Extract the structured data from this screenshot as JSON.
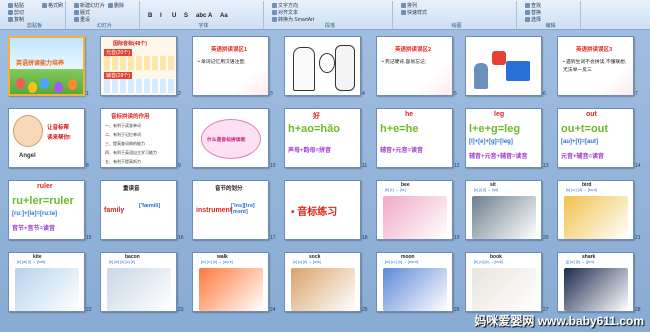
{
  "ribbon": {
    "groups": [
      {
        "label": "剪贴板",
        "buttons": [
          "粘贴",
          "剪切",
          "复制",
          "格式刷"
        ]
      },
      {
        "label": "幻灯片",
        "buttons": [
          "新建幻灯片",
          "版式",
          "重设",
          "删除"
        ]
      },
      {
        "label": "字体",
        "buttons": [
          "B",
          "I",
          "U",
          "S",
          "abc",
          "A",
          "Aa"
        ]
      },
      {
        "label": "段落",
        "buttons": [
          "文字方向",
          "对齐文本",
          "转换为 SmartArt"
        ]
      },
      {
        "label": "绘图",
        "buttons": [
          "排列",
          "快速样式"
        ]
      },
      {
        "label": "编辑",
        "buttons": [
          "查找",
          "替换",
          "选择"
        ]
      }
    ]
  },
  "slides": [
    {
      "n": "1",
      "title": "英语拼读能力培养",
      "kind": "cover"
    },
    {
      "n": "2",
      "lines": [
        "国际音标(48个)",
        "元音(20个)",
        "辅音(28个)"
      ],
      "kind": "ipa"
    },
    {
      "n": "3",
      "title": "英语拼读误区1",
      "body": "单词记忆用汉语注音;",
      "kind": "text"
    },
    {
      "n": "4",
      "kind": "cartoon"
    },
    {
      "n": "5",
      "title": "英语拼读误区2",
      "body": "死记硬背,容易忘记;",
      "kind": "text"
    },
    {
      "n": "6",
      "kind": "question"
    },
    {
      "n": "7",
      "title": "英语拼读误区3",
      "body": "遇到生词不会拼读,不懂联想,无法举一反三",
      "kind": "text"
    },
    {
      "n": "8",
      "text1": "让音标帮",
      "text2": "读来帮你!",
      "name": "Angel",
      "kind": "angel"
    },
    {
      "n": "9",
      "title": "音标拼读的作用",
      "lines": [
        "一、有利于读准单词",
        "二、有利于记忆单词",
        "三、提高查词典的能力",
        "四、有利于英语自主学习能力",
        "五、有利于提高听力"
      ],
      "kind": "list"
    },
    {
      "n": "10",
      "title": "什么是音标拼读呢",
      "kind": "bubble"
    },
    {
      "n": "11",
      "top": "好",
      "formula": "h+ao=hǎo",
      "sub": "声母+韵母=拼音",
      "kind": "formula"
    },
    {
      "n": "12",
      "top": "he",
      "formula": "h+e=he",
      "sub": "辅音+元音=读音",
      "kind": "formula"
    },
    {
      "n": "13",
      "top": "leg",
      "formula": "l+e+g=leg",
      "mid": "[l]+[e]+[g]=[leg]",
      "sub": "辅音+元音+辅音=读音",
      "kind": "formula"
    },
    {
      "n": "14",
      "top": "out",
      "formula": "ou+t=out",
      "mid": "[au]+[t]=[aut]",
      "sub": "元音+辅音=读音",
      "kind": "formula"
    },
    {
      "n": "15",
      "top": "ruler",
      "formula": "ru+ler=ruler",
      "mid": "[ru:]+[lə]=[ru:lə]",
      "sub": "音节+音节=读音",
      "kind": "formula"
    },
    {
      "n": "16",
      "title": "重读音",
      "word": "family",
      "ipa": "['fæmili]",
      "kind": "stress"
    },
    {
      "n": "17",
      "title": "音节的划分",
      "word": "instrument",
      "ipa": "['ins][trə][mənt]",
      "kind": "stress"
    },
    {
      "n": "18",
      "title": "音标练习",
      "kind": "practice"
    },
    {
      "n": "19",
      "word": "bee",
      "ipa": "[b] [i:] → [bi:]",
      "kind": "photo"
    },
    {
      "n": "20",
      "word": "sit",
      "ipa": "[s] [i] [t] → [sit]",
      "kind": "photo"
    },
    {
      "n": "21",
      "word": "bird",
      "ipa": "[b] [ə:] [d] → [bə:d]",
      "kind": "photo"
    },
    {
      "n": "22",
      "word": "kite",
      "ipa": "[k] [ai] [t] → [kait]",
      "kind": "photo"
    },
    {
      "n": "23",
      "word": "bacon",
      "ipa": "[b] [ei] [k] [ə] [n]",
      "kind": "photo"
    },
    {
      "n": "24",
      "word": "walk",
      "ipa": "[w] [ɔ:] [k] → [wɔ:k]",
      "kind": "photo"
    },
    {
      "n": "25",
      "word": "sock",
      "ipa": "[s] [ɔ] [k] → [sɔk]",
      "kind": "photo"
    },
    {
      "n": "26",
      "word": "moon",
      "ipa": "[m] [u:] [n] → [mu:n]",
      "kind": "photo"
    },
    {
      "n": "27",
      "word": "book",
      "ipa": "[b] [u] [k] → [buk]",
      "kind": "photo"
    },
    {
      "n": "28",
      "word": "shark",
      "ipa": "[ʃ] [ɑ:] [k] → [ʃɑ:k]",
      "kind": "photo"
    }
  ],
  "watermark": "妈咪爱婴网 www.baby611.com"
}
